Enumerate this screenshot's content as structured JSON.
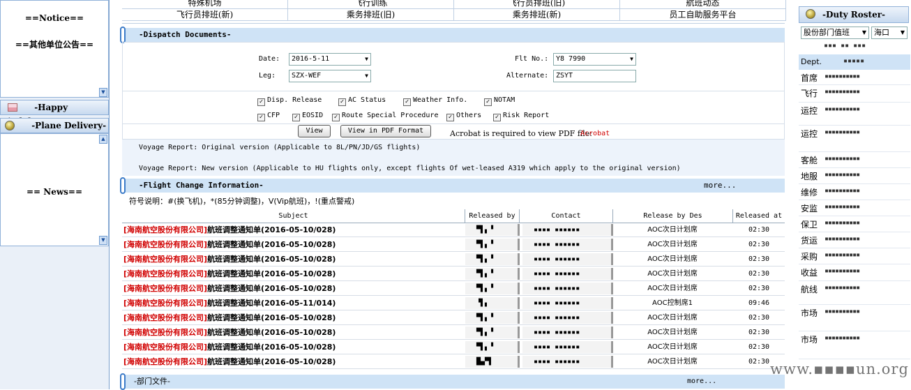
{
  "left": {
    "notice_title": "==Notice==",
    "other_title": "==其他单位公告==",
    "birthday_title": "-Happy Birthday-",
    "plane_title": "-Plane Delivery-",
    "news_title": "== News=="
  },
  "nav": {
    "row1": [
      "特殊机场",
      "飞行训练",
      "飞行员排班(旧)",
      "航班动态"
    ],
    "row2": [
      "飞行员排班(新)",
      "乘务排班(旧)",
      "乘务排班(新)",
      "员工自助服务平台"
    ]
  },
  "dispatch": {
    "title": "-Dispatch Documents-",
    "date_label": "Date:",
    "date_value": "2016-5-11",
    "flt_label": "Flt No.:",
    "flt_value": "Y8 7990",
    "leg_label": "Leg:",
    "leg_value": "SZX-WEF",
    "alt_label": "Alternate:",
    "alt_value": "ZSYT",
    "checks_row1": [
      "Disp. Release",
      "AC Status",
      "Weather Info.",
      "NOTAM"
    ],
    "checks_row2": [
      "CFP",
      "EOSID",
      "Route Special Procedure",
      "Others",
      "Risk Report"
    ],
    "view_button": "View",
    "pdf_button": "View in PDF Format",
    "acrobat_note": "Acrobat is required to view PDF file:",
    "acrobat_link": "Acrobat",
    "voyage1": "Voyage Report: Original version (Applicable to 8L/PN/JD/GS flights)",
    "voyage2": "Voyage Report: New version (Applicable to HU flights only, except flights Of wet-leased A319 which apply to the original version)"
  },
  "flight_change": {
    "title": "-Flight Change Information-",
    "more": "more...",
    "legend": "符号说明：#(换飞机)，*(85分钟调整)，V(Vip航班)，!(重点警戒)",
    "headers": [
      "Subject",
      "Released by",
      "Contact",
      "Release by Des",
      "Released at"
    ],
    "rows": [
      {
        "company": "[海南航空股份有限公司]",
        "subject": "航班调整通知单(2016-05-10/028)",
        "released_by": "▀▌▖▝",
        "contact": "▪▪▪▪ ▪▪▪▪▪▪",
        "des": "AOC次日计划席",
        "at": "02:30"
      },
      {
        "company": "[海南航空股份有限公司]",
        "subject": "航班调整通知单(2016-05-10/028)",
        "released_by": "▀▌▖▝",
        "contact": "▪▪▪▪ ▪▪▪▪▪▪",
        "des": "AOC次日计划席",
        "at": "02:30"
      },
      {
        "company": "[海南航空股份有限公司]",
        "subject": "航班调整通知单(2016-05-10/028)",
        "released_by": "▀▌▖▝",
        "contact": "▪▪▪▪ ▪▪▪▪▪▪",
        "des": "AOC次日计划席",
        "at": "02:30"
      },
      {
        "company": "[海南航空股份有限公司]",
        "subject": "航班调整通知单(2016-05-10/028)",
        "released_by": "▀▌▖▝",
        "contact": "▪▪▪▪ ▪▪▪▪▪▪",
        "des": "AOC次日计划席",
        "at": "02:30"
      },
      {
        "company": "[海南航空股份有限公司]",
        "subject": "航班调整通知单(2016-05-10/028)",
        "released_by": "▀▌▖▝",
        "contact": "▪▪▪▪ ▪▪▪▪▪▪",
        "des": "AOC次日计划席",
        "at": "02:30"
      },
      {
        "company": "[海南航空股份有限公司]",
        "subject": "航班调整通知单(2016-05-11/014)",
        "released_by": "▝▌▖",
        "contact": "▪▪▪▪ ▪▪▪▪▪▪",
        "des": "AOC控制席1",
        "at": "09:46"
      },
      {
        "company": "[海南航空股份有限公司]",
        "subject": "航班调整通知单(2016-05-10/028)",
        "released_by": "▀▌▖▝",
        "contact": "▪▪▪▪ ▪▪▪▪▪▪",
        "des": "AOC次日计划席",
        "at": "02:30"
      },
      {
        "company": "[海南航空股份有限公司]",
        "subject": "航班调整通知单(2016-05-10/028)",
        "released_by": "▀▌▖▝",
        "contact": "▪▪▪▪ ▪▪▪▪▪▪",
        "des": "AOC次日计划席",
        "at": "02:30"
      },
      {
        "company": "[海南航空股份有限公司]",
        "subject": "航班调整通知单(2016-05-10/028)",
        "released_by": "▀▌▖▝",
        "contact": "▪▪▪▪ ▪▪▪▪▪▪",
        "des": "AOC次日计划席",
        "at": "02:30"
      },
      {
        "company": "[海南航空股份有限公司]",
        "subject": "航班调整通知单(2016-05-10/028)",
        "released_by": "█▄▀▌",
        "contact": "▪▪▪▪ ▪▪▪▪▪▪",
        "des": "AOC次日计划席",
        "at": "02:30"
      }
    ]
  },
  "dept_docs": {
    "title": "-部门文件-",
    "more": "more..."
  },
  "duty": {
    "title": "-Duty Roster-",
    "dept_select": "股份部门值班",
    "city_select": "海口",
    "date_masked": "▪▪▪ ▪▪ ▪▪▪",
    "header_dept": "Dept.",
    "header_value": "▪▪▪▪▪",
    "rows": [
      {
        "dept": "首席",
        "value": "▪▪▪▪▪▪▪▪▪▪"
      },
      {
        "dept": "飞行",
        "value": "▪▪▪▪▪▪▪▪▪▪"
      },
      {
        "dept": "运控",
        "value": "▪▪▪▪▪▪▪▪▪▪"
      },
      {
        "dept": "运控",
        "value": "▪▪▪▪▪▪▪▪▪▪"
      },
      {
        "dept": "客舱",
        "value": "▪▪▪▪▪▪▪▪▪▪"
      },
      {
        "dept": "地服",
        "value": "▪▪▪▪▪▪▪▪▪▪"
      },
      {
        "dept": "维修",
        "value": "▪▪▪▪▪▪▪▪▪▪"
      },
      {
        "dept": "安监",
        "value": "▪▪▪▪▪▪▪▪▪▪"
      },
      {
        "dept": "保卫",
        "value": "▪▪▪▪▪▪▪▪▪▪"
      },
      {
        "dept": "货运",
        "value": "▪▪▪▪▪▪▪▪▪▪"
      },
      {
        "dept": "采购",
        "value": "▪▪▪▪▪▪▪▪▪▪"
      },
      {
        "dept": "收益",
        "value": "▪▪▪▪▪▪▪▪▪▪"
      },
      {
        "dept": "航线",
        "value": "▪▪▪▪▪▪▪▪▪▪"
      },
      {
        "dept": "市场",
        "value": "▪▪▪▪▪▪▪▪▪▪"
      },
      {
        "dept": "市场",
        "value": "▪▪▪▪▪▪▪▪▪▪"
      }
    ]
  }
}
